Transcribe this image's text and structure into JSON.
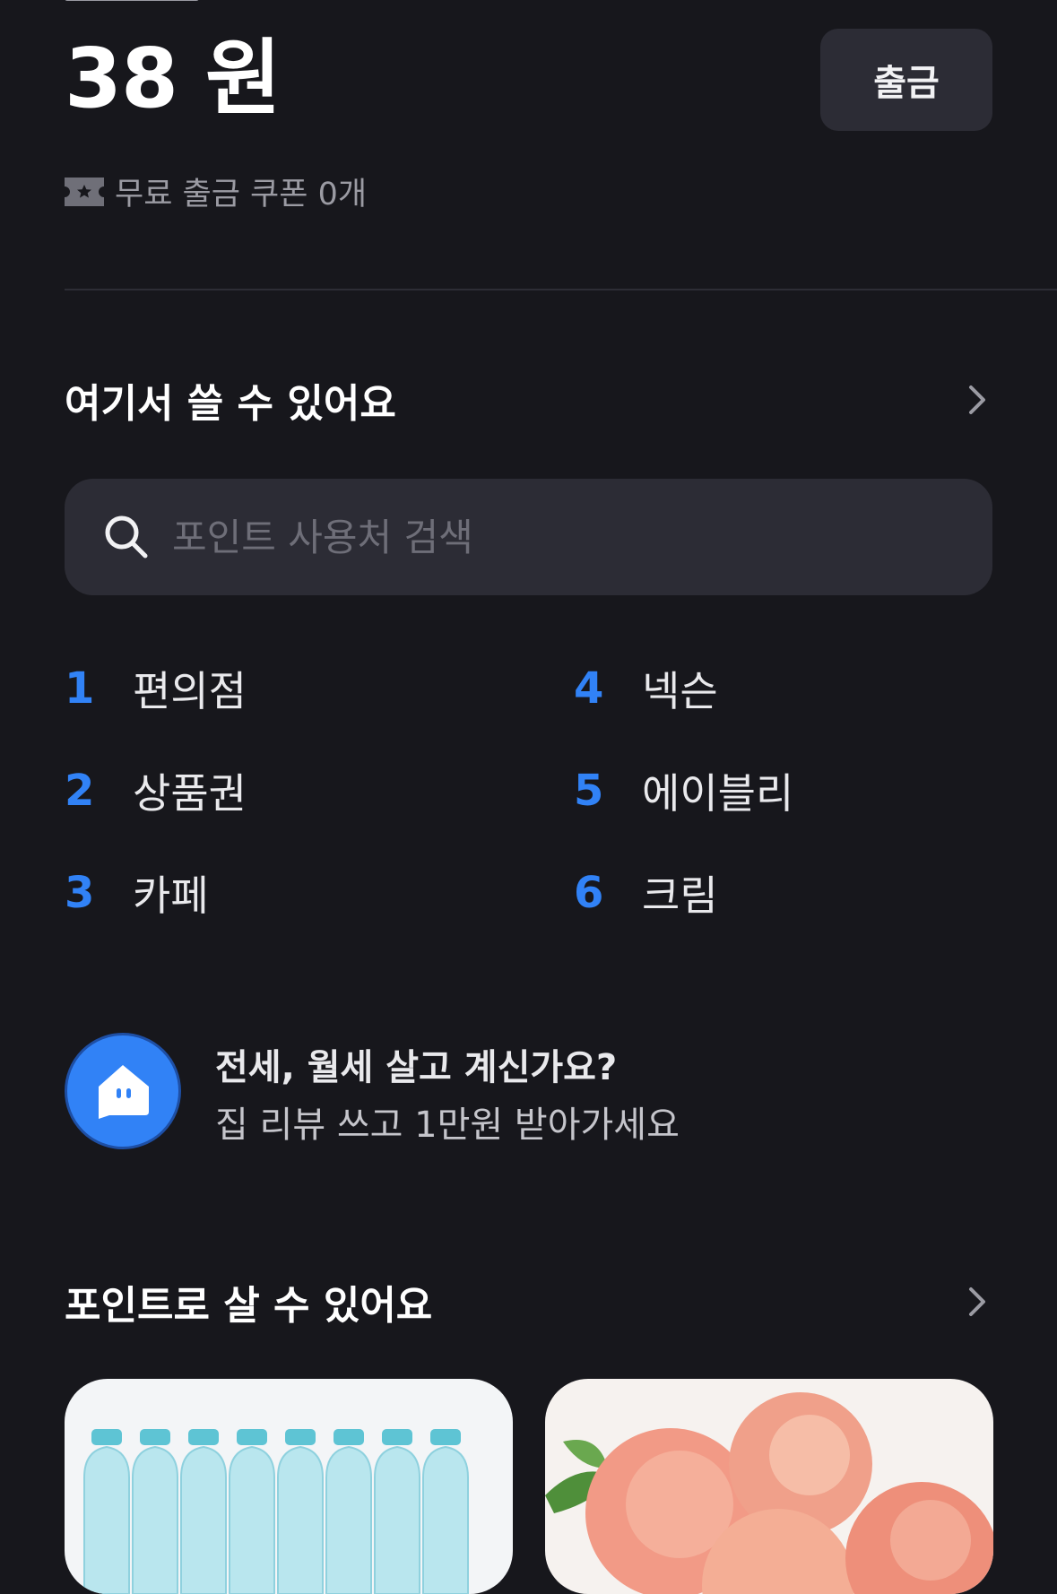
{
  "header": {
    "balance": "38 원",
    "withdraw_label": "출금",
    "coupon_text": "무료 출금 쿠폰 0개"
  },
  "usable_section": {
    "title": "여기서 쓸 수 있어요",
    "search": {
      "placeholder": "포인트 사용처 검색",
      "value": ""
    },
    "ranking": [
      {
        "rank": "1",
        "label": "편의점"
      },
      {
        "rank": "2",
        "label": "상품권"
      },
      {
        "rank": "3",
        "label": "카페"
      },
      {
        "rank": "4",
        "label": "넥슨"
      },
      {
        "rank": "5",
        "label": "에이블리"
      },
      {
        "rank": "6",
        "label": "크림"
      }
    ]
  },
  "promo": {
    "title": "전세, 월세 살고 계신가요?",
    "subtitle": "집 리뷰 쓰고 1만원 받아가세요",
    "icon": "house-chat-icon"
  },
  "buy_section": {
    "title": "포인트로 살 수 있어요",
    "products": [
      {
        "icon": "water-bottles-image"
      },
      {
        "icon": "peaches-image"
      }
    ]
  },
  "colors": {
    "background": "#17171c",
    "accent": "#3182f6",
    "surface": "#2c2c35"
  }
}
